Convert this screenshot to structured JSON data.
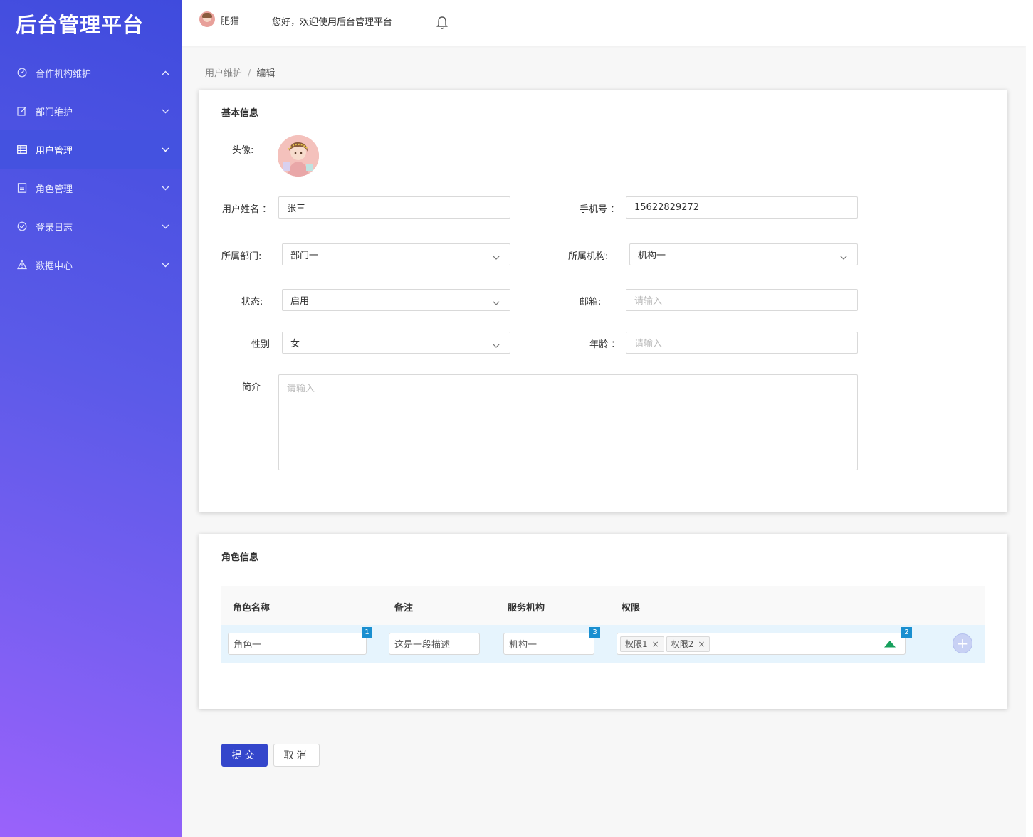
{
  "app": {
    "title": "后台管理平台"
  },
  "sidebar": {
    "items": [
      {
        "label": "合作机构维护",
        "icon": "dashboard-icon",
        "expanded": true
      },
      {
        "label": "部门维护",
        "icon": "edit-icon",
        "expanded": false
      },
      {
        "label": "用户管理",
        "icon": "table-icon",
        "expanded": false,
        "active": true
      },
      {
        "label": "角色管理",
        "icon": "document-icon",
        "expanded": false
      },
      {
        "label": "登录日志",
        "icon": "check-circle-icon",
        "expanded": false
      },
      {
        "label": "数据中心",
        "icon": "warning-icon",
        "expanded": false
      }
    ],
    "gradient": [
      "#3f4bdd",
      "#9a62fb"
    ],
    "active_color": "#4452e0"
  },
  "header": {
    "user_name": "肥猫",
    "welcome": "您好，欢迎使用后台管理平台"
  },
  "breadcrumb": {
    "parent": "用户维护",
    "separator": "/",
    "current": "编辑"
  },
  "basic_info": {
    "title": "基本信息",
    "avatar_label": "头像:",
    "name_label": "用户姓名 ：",
    "name_value": "张三",
    "phone_label": "手机号 ：",
    "phone_value": "15622829272",
    "dept_label": "所属部门:",
    "dept_value": "部门一",
    "org_label": "所属机构:",
    "org_value": "机构一",
    "status_label": "状态:",
    "status_value": "启用",
    "email_label": "邮箱:",
    "email_placeholder": "请输入",
    "gender_label": "性别",
    "gender_value": "女",
    "age_label": "年龄 ：",
    "age_placeholder": "请输入",
    "intro_label": "简介",
    "intro_placeholder": "请输入"
  },
  "role_info": {
    "title": "角色信息",
    "columns": [
      "角色名称",
      "备注",
      "服务机构",
      "权限"
    ],
    "row": {
      "role_name": "角色一",
      "role_badge": "1",
      "remark": "这是一段描述",
      "service_org": "机构一",
      "service_badge": "3",
      "permissions": [
        "权限1",
        "权限2"
      ],
      "permission_badge": "2",
      "tag_close": "×"
    },
    "add_symbol": "+"
  },
  "actions": {
    "submit": "提交",
    "cancel": "取消"
  },
  "colors": {
    "primary": "#3446cb",
    "badge": "#1a8fd0",
    "row_highlight": "#e6f4fd",
    "up_arrow": "#17a05d"
  }
}
